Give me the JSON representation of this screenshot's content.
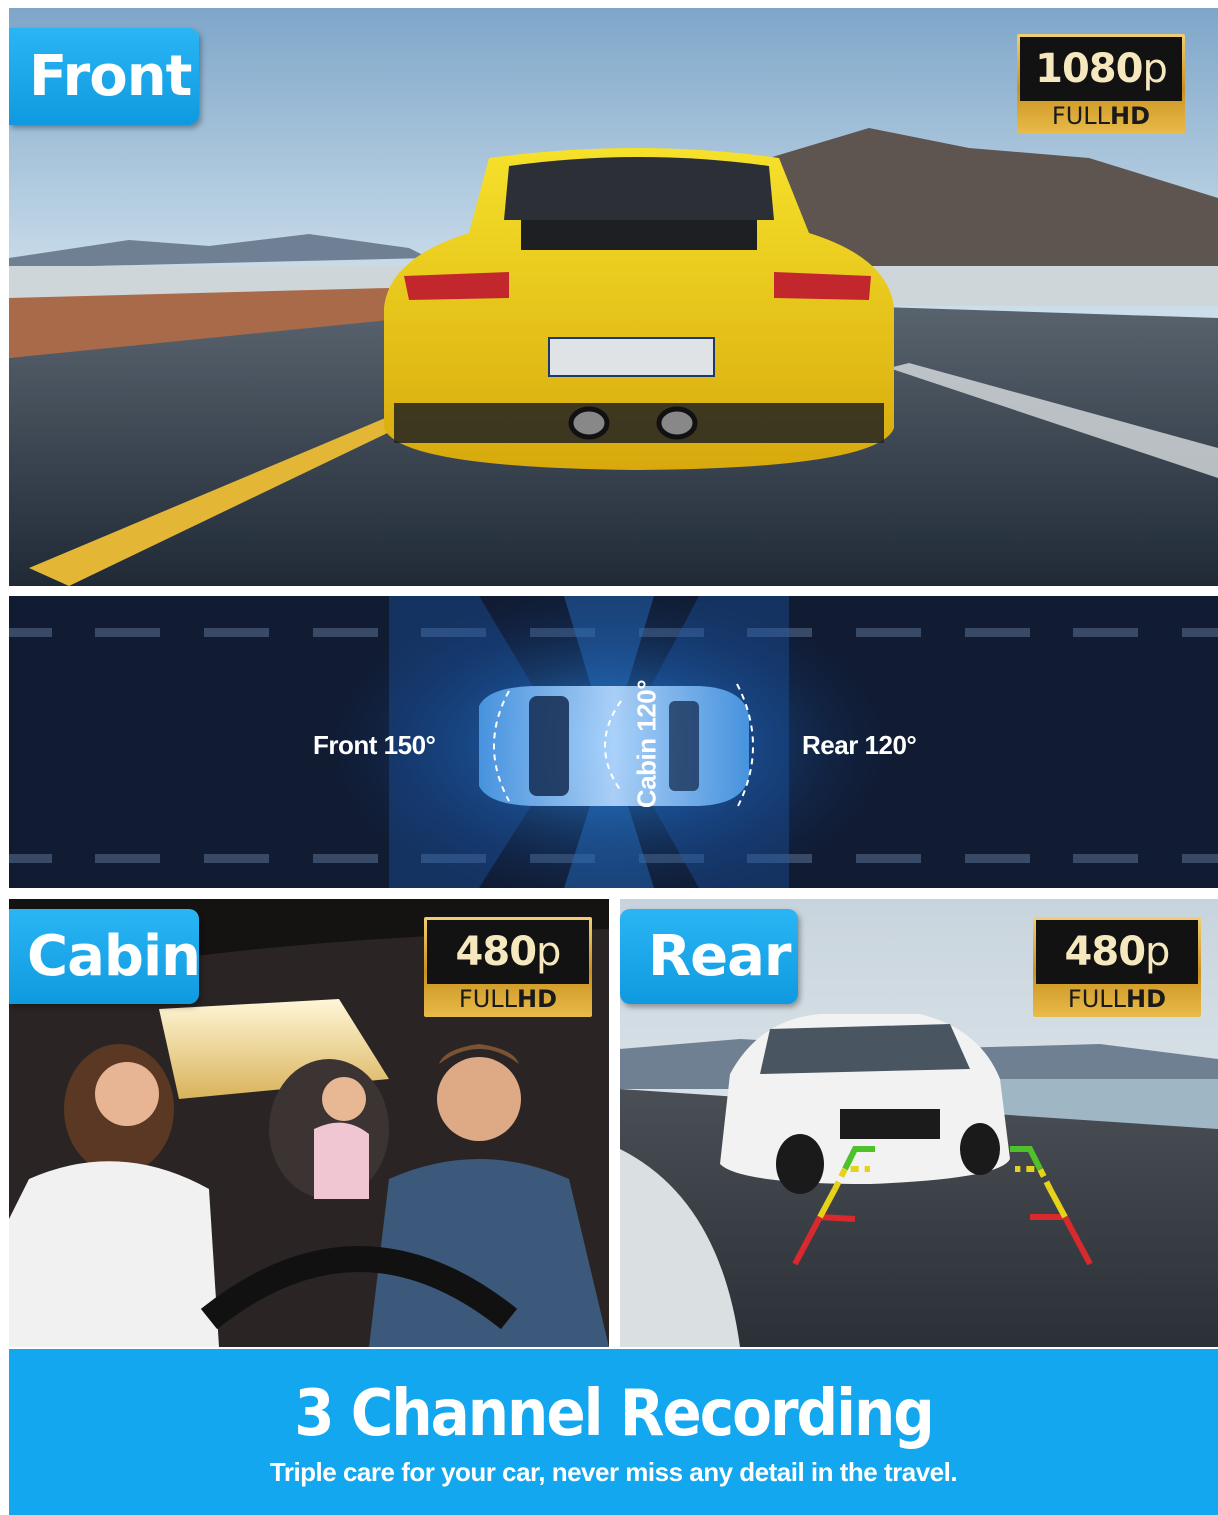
{
  "front": {
    "tag": "Front",
    "resolution": {
      "value": "1080",
      "suffix": "p",
      "label_light": "FULL",
      "label_bold": "HD"
    }
  },
  "fov": {
    "front_label": "Front 150°",
    "cabin_label": "Cabin 120°",
    "rear_label": "Rear 120°"
  },
  "cabin": {
    "tag": "Cabin",
    "resolution": {
      "value": "480",
      "suffix": "p",
      "label_light": "FULL",
      "label_bold": "HD"
    }
  },
  "rear": {
    "tag": "Rear",
    "resolution": {
      "value": "480",
      "suffix": "p",
      "label_light": "FULL",
      "label_bold": "HD"
    }
  },
  "footer": {
    "title": "3 Channel Recording",
    "subtitle": "Triple care for your car, never miss any detail in the travel."
  },
  "colors": {
    "accent_blue": "#12a7ef",
    "dark_navy": "#111c33",
    "gold": "#d6a434",
    "car_yellow": "#f2d21a"
  }
}
